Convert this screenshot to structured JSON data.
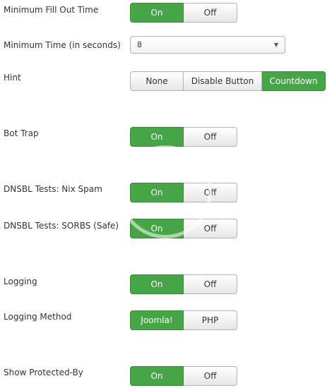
{
  "rows": [
    {
      "label": "Minimum Fill Out Time",
      "options": [
        "On",
        "Off"
      ],
      "selected": "On"
    },
    {
      "label": "Minimum Time (in seconds)",
      "value": "8"
    },
    {
      "label": "Hint",
      "options": [
        "None",
        "Disable Button",
        "Countdown"
      ],
      "selected": "Countdown"
    },
    {
      "label": "Bot Trap",
      "options": [
        "On",
        "Off"
      ],
      "selected": "On"
    },
    {
      "label": "DNSBL Tests: Nix Spam",
      "options": [
        "On",
        "Off"
      ],
      "selected": "On"
    },
    {
      "label": "DNSBL Tests: SORBS (Safe)",
      "options": [
        "On",
        "Off"
      ],
      "selected": "On"
    },
    {
      "label": "Logging",
      "options": [
        "On",
        "Off"
      ],
      "selected": "On"
    },
    {
      "label": "Logging Method",
      "options": [
        "Joomla!",
        "PHP"
      ],
      "selected": "Joomla!"
    },
    {
      "label": "Show Protected-By",
      "options": [
        "On",
        "Off"
      ],
      "selected": "On"
    }
  ],
  "icons": {
    "select_caret": "caret-down-icon",
    "watermark": "watermark-logo"
  },
  "colors": {
    "active": "#46a546",
    "border": "#b3b3b3",
    "text": "#333333"
  }
}
